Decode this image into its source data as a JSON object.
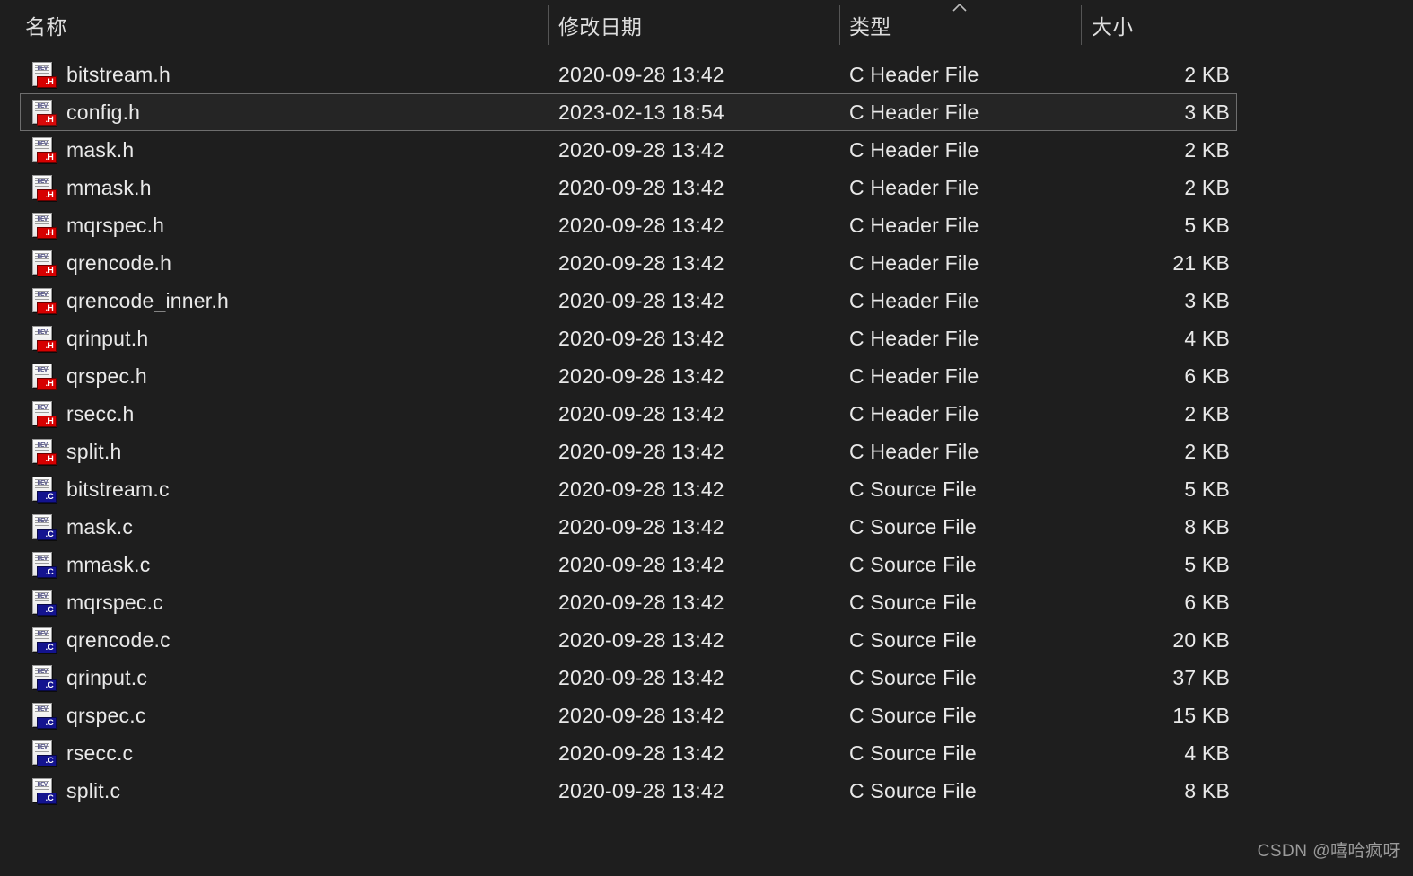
{
  "window": {
    "background_color": "#1e1e1e",
    "text_color": "#e9e9e9"
  },
  "columns": {
    "name": {
      "label": "名称",
      "key": "name"
    },
    "date_modified": {
      "label": "修改日期",
      "key": "date"
    },
    "type": {
      "label": "类型",
      "key": "type"
    },
    "size": {
      "label": "大小",
      "key": "size"
    }
  },
  "sort": {
    "column": "类型",
    "direction": "ascending",
    "indicator_icon": "caret-up-icon"
  },
  "selection": {
    "selected_row_index": 1,
    "selected_file": "config.h",
    "outline_color": "#6e6e6e"
  },
  "icons": {
    "header_sort": "caret-up-icon",
    "c_header_file": "c-header-file-icon",
    "c_source_file": "c-source-file-icon",
    "badge_h_color": "#d60000",
    "badge_c_color": "#13138f"
  },
  "rows": [
    {
      "name": "bitstream.h",
      "date": "2020-09-28 13:42",
      "type": "C Header File",
      "size": "2 KB",
      "ext": "h"
    },
    {
      "name": "config.h",
      "date": "2023-02-13 18:54",
      "type": "C Header File",
      "size": "3 KB",
      "ext": "h"
    },
    {
      "name": "mask.h",
      "date": "2020-09-28 13:42",
      "type": "C Header File",
      "size": "2 KB",
      "ext": "h"
    },
    {
      "name": "mmask.h",
      "date": "2020-09-28 13:42",
      "type": "C Header File",
      "size": "2 KB",
      "ext": "h"
    },
    {
      "name": "mqrspec.h",
      "date": "2020-09-28 13:42",
      "type": "C Header File",
      "size": "5 KB",
      "ext": "h"
    },
    {
      "name": "qrencode.h",
      "date": "2020-09-28 13:42",
      "type": "C Header File",
      "size": "21 KB",
      "ext": "h"
    },
    {
      "name": "qrencode_inner.h",
      "date": "2020-09-28 13:42",
      "type": "C Header File",
      "size": "3 KB",
      "ext": "h"
    },
    {
      "name": "qrinput.h",
      "date": "2020-09-28 13:42",
      "type": "C Header File",
      "size": "4 KB",
      "ext": "h"
    },
    {
      "name": "qrspec.h",
      "date": "2020-09-28 13:42",
      "type": "C Header File",
      "size": "6 KB",
      "ext": "h"
    },
    {
      "name": "rsecc.h",
      "date": "2020-09-28 13:42",
      "type": "C Header File",
      "size": "2 KB",
      "ext": "h"
    },
    {
      "name": "split.h",
      "date": "2020-09-28 13:42",
      "type": "C Header File",
      "size": "2 KB",
      "ext": "h"
    },
    {
      "name": "bitstream.c",
      "date": "2020-09-28 13:42",
      "type": "C Source File",
      "size": "5 KB",
      "ext": "c"
    },
    {
      "name": "mask.c",
      "date": "2020-09-28 13:42",
      "type": "C Source File",
      "size": "8 KB",
      "ext": "c"
    },
    {
      "name": "mmask.c",
      "date": "2020-09-28 13:42",
      "type": "C Source File",
      "size": "5 KB",
      "ext": "c"
    },
    {
      "name": "mqrspec.c",
      "date": "2020-09-28 13:42",
      "type": "C Source File",
      "size": "6 KB",
      "ext": "c"
    },
    {
      "name": "qrencode.c",
      "date": "2020-09-28 13:42",
      "type": "C Source File",
      "size": "20 KB",
      "ext": "c"
    },
    {
      "name": "qrinput.c",
      "date": "2020-09-28 13:42",
      "type": "C Source File",
      "size": "37 KB",
      "ext": "c"
    },
    {
      "name": "qrspec.c",
      "date": "2020-09-28 13:42",
      "type": "C Source File",
      "size": "15 KB",
      "ext": "c"
    },
    {
      "name": "rsecc.c",
      "date": "2020-09-28 13:42",
      "type": "C Source File",
      "size": "4 KB",
      "ext": "c"
    },
    {
      "name": "split.c",
      "date": "2020-09-28 13:42",
      "type": "C Source File",
      "size": "8 KB",
      "ext": "c"
    }
  ],
  "badge_labels": {
    "h": ".H",
    "c": ".C"
  },
  "icon_page_glyph": "DEV",
  "watermark": {
    "text": "CSDN @嘻哈疯呀"
  }
}
